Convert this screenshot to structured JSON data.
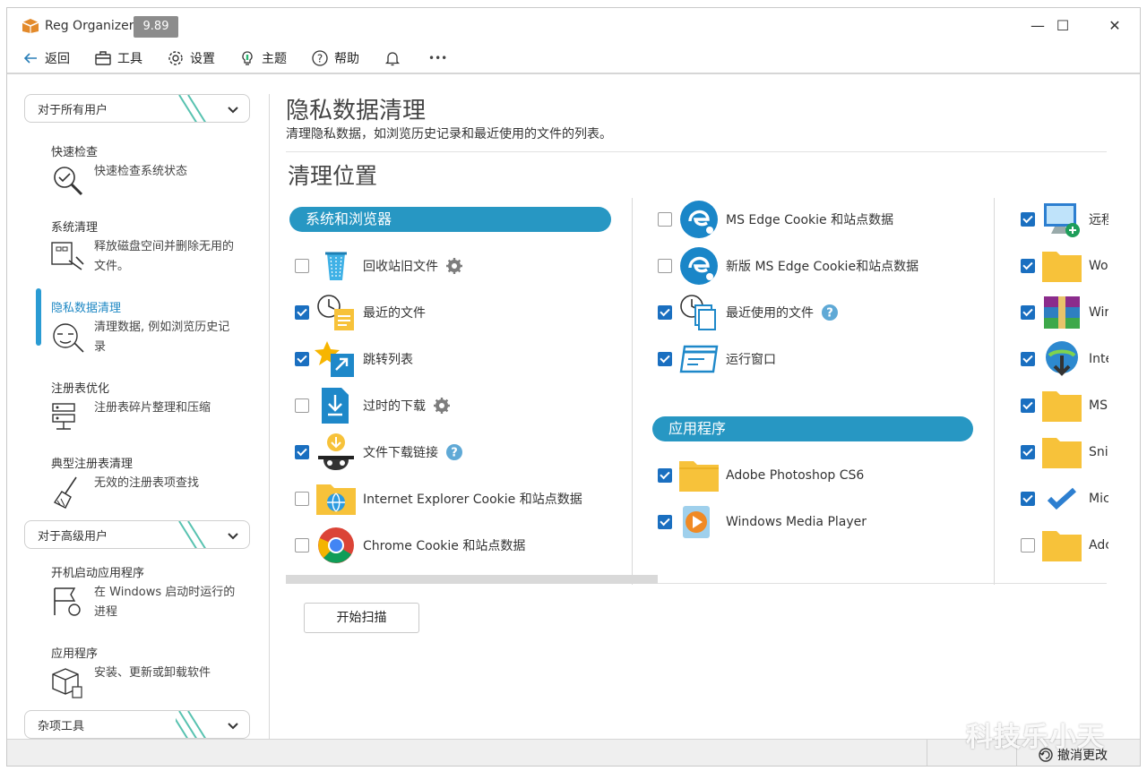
{
  "titlebar": {
    "app_name": "Reg Organizer",
    "version": "9.89",
    "minimize": "—",
    "maximize": "☐",
    "close": "✕"
  },
  "toolbar": {
    "back": "返回",
    "tools": "工具",
    "settings": "设置",
    "theme": "主题",
    "help": "帮助",
    "more": "•••"
  },
  "sidebar": {
    "group_all_users": "对于所有用户",
    "group_advanced": "对于高级用户",
    "group_misc": "杂项工具",
    "items": [
      {
        "title": "快速检查",
        "desc": "快速检查系统状态"
      },
      {
        "title": "系统清理",
        "desc": "释放磁盘空间并删除无用的文件。"
      },
      {
        "title": "隐私数据清理",
        "desc": "清理数据, 例如浏览历史记录"
      },
      {
        "title": "注册表优化",
        "desc": "注册表碎片整理和压缩"
      },
      {
        "title": "典型注册表清理",
        "desc": "无效的注册表项查找"
      },
      {
        "title": "开机启动应用程序",
        "desc": "在 Windows 启动时运行的进程"
      },
      {
        "title": "应用程序",
        "desc": "安装、更新或卸载软件"
      }
    ]
  },
  "main": {
    "page_title": "隐私数据清理",
    "page_subtitle": "清理隐私数据，如浏览历史记录和最近使用的文件的列表。",
    "section_title": "清理位置",
    "cat_system": "系统和浏览器",
    "cat_apps": "应用程序",
    "col1": [
      {
        "label": "回收站旧文件",
        "checked": false
      },
      {
        "label": "最近的文件",
        "checked": true
      },
      {
        "label": "跳转列表",
        "checked": true
      },
      {
        "label": "过时的下载",
        "checked": false
      },
      {
        "label": "文件下载链接",
        "checked": true
      },
      {
        "label": "Internet Explorer Cookie 和站点数据",
        "checked": false
      },
      {
        "label": "Chrome Cookie 和站点数据",
        "checked": false
      }
    ],
    "col2": [
      {
        "label": "MS Edge Cookie 和站点数据",
        "checked": false
      },
      {
        "label": "新版 MS Edge Cookie和站点数据",
        "checked": false
      },
      {
        "label": "最近使用的文件",
        "checked": true
      },
      {
        "label": "运行窗口",
        "checked": true
      }
    ],
    "col2_apps": [
      {
        "label": "Adobe Photoshop CS6",
        "checked": true
      },
      {
        "label": "Windows Media Player",
        "checked": true
      }
    ],
    "col3": [
      {
        "label": "远程",
        "checked": true
      },
      {
        "label": "Wo",
        "checked": true
      },
      {
        "label": "Wir",
        "checked": true
      },
      {
        "label": "Inte",
        "checked": true
      },
      {
        "label": "MS",
        "checked": true
      },
      {
        "label": "Snip",
        "checked": true
      },
      {
        "label": "Mic",
        "checked": true
      },
      {
        "label": "Adc",
        "checked": false
      }
    ],
    "scan_button": "开始扫描"
  },
  "statusbar": {
    "undo": "撤消更改"
  },
  "watermark": "科技乐小天",
  "colors": {
    "accent": "#2797c3",
    "checkbox": "#1a6fc0",
    "active_nav": "#1f88c4",
    "folder": "#f7c23a"
  }
}
